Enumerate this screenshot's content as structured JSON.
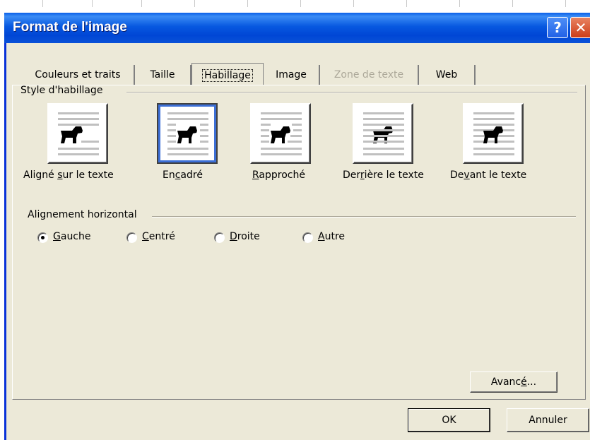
{
  "dialog": {
    "title": "Format de l'image",
    "help_glyph": "?",
    "close_glyph": "✕"
  },
  "tabs": [
    {
      "label": "Couleurs et traits"
    },
    {
      "label": "Taille"
    },
    {
      "label": "Habillage"
    },
    {
      "label": "Image"
    },
    {
      "label": "Zone de texte"
    },
    {
      "label": "Web"
    }
  ],
  "wrap_style": {
    "group_title": "Style d'habillage",
    "selected": "Encadré",
    "options": [
      {
        "pre": "Aligné ",
        "key": "s",
        "post": "ur le texte",
        "icon": "wrap-inline-icon"
      },
      {
        "pre": "En",
        "key": "c",
        "post": "adré",
        "icon": "wrap-square-icon"
      },
      {
        "pre": "",
        "key": "R",
        "post": "approché",
        "icon": "wrap-tight-icon"
      },
      {
        "pre": "Der",
        "key": "r",
        "post": "ière le texte",
        "icon": "wrap-behind-text-icon"
      },
      {
        "pre": "De",
        "key": "v",
        "post": "ant le texte",
        "icon": "wrap-in-front-icon"
      }
    ]
  },
  "alignment": {
    "group_title": "Alignement horizontal",
    "selected": "Gauche",
    "options": [
      {
        "key": "G",
        "post": "auche"
      },
      {
        "key": "C",
        "post": "entré"
      },
      {
        "key": "D",
        "post": "roite"
      },
      {
        "key": "A",
        "post": "utre"
      }
    ]
  },
  "buttons": {
    "advanced": {
      "pre": "Avanc",
      "key": "é",
      "post": "..."
    },
    "ok": "OK",
    "cancel": "Annuler"
  },
  "colors": {
    "titlebar": "#0758e0",
    "dialog_bg": "#ece9d8",
    "selection": "#3c6fd6"
  }
}
